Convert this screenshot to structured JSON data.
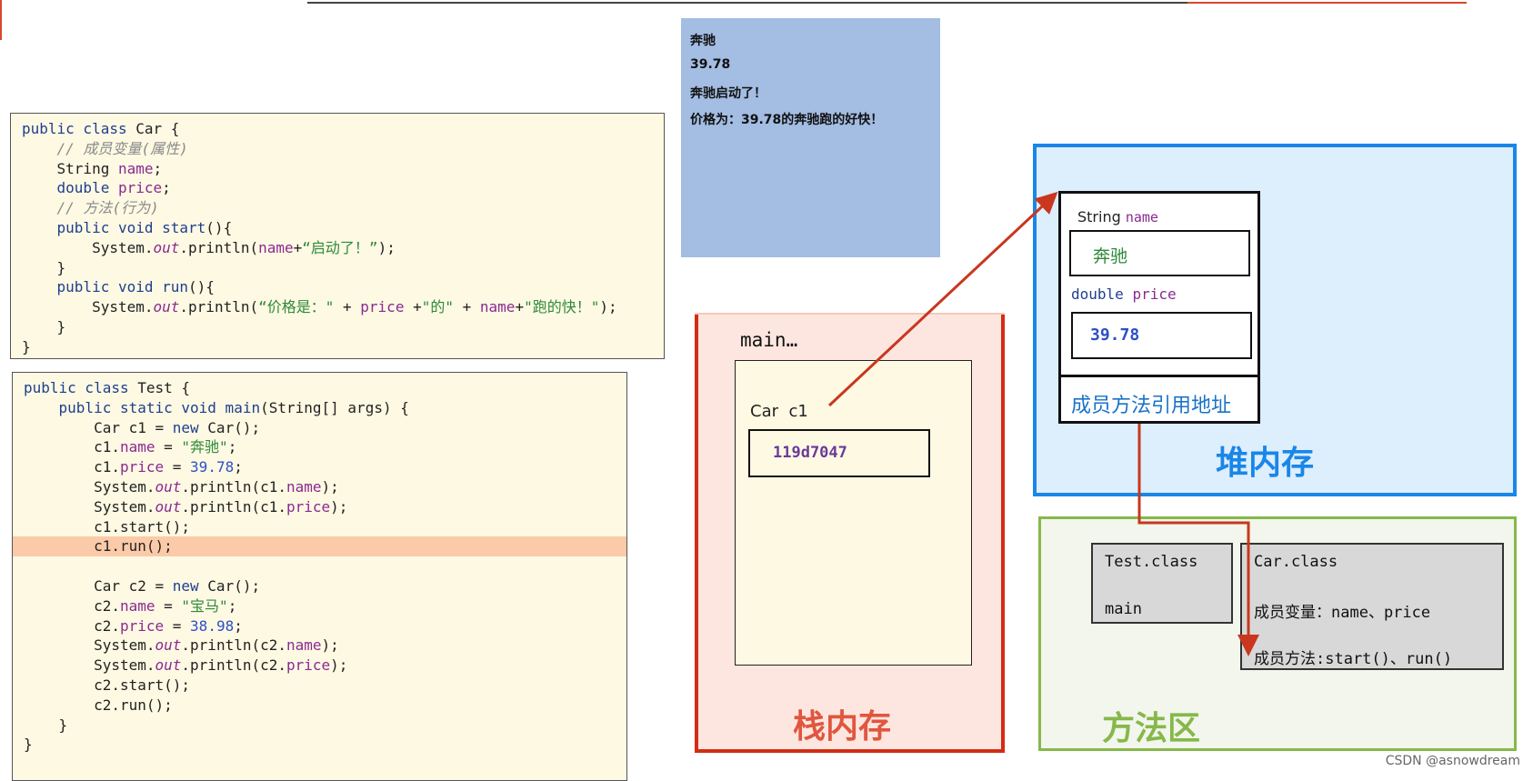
{
  "car_code": [
    [
      [
        "public class ",
        "kw"
      ],
      [
        "Car {",
        ""
      ]
    ],
    [
      [
        "    ",
        ""
      ],
      [
        "// 成员变量(属性)",
        "cm"
      ]
    ],
    [
      [
        "    String ",
        ""
      ],
      [
        "name",
        "fld"
      ],
      [
        ";",
        ""
      ]
    ],
    [
      [
        "    ",
        ""
      ],
      [
        "double ",
        "kw"
      ],
      [
        "price",
        "fld"
      ],
      [
        ";",
        ""
      ]
    ],
    [
      [
        "    ",
        ""
      ],
      [
        "// 方法(行为)",
        "cm"
      ]
    ],
    [
      [
        "    ",
        ""
      ],
      [
        "public void start",
        "kw"
      ],
      [
        "(){",
        ""
      ]
    ],
    [
      [
        "        System.",
        ""
      ],
      [
        "out",
        "it"
      ],
      [
        ".println(",
        ""
      ],
      [
        "name",
        "fld"
      ],
      [
        "+",
        ""
      ],
      [
        "“启动了！”",
        "str"
      ],
      [
        ");",
        ""
      ]
    ],
    [
      [
        "    }",
        ""
      ]
    ],
    [
      [
        "    ",
        ""
      ],
      [
        "public void run",
        "kw"
      ],
      [
        "(){",
        ""
      ]
    ],
    [
      [
        "        System.",
        ""
      ],
      [
        "out",
        "it"
      ],
      [
        ".println(",
        ""
      ],
      [
        "“价格是：\" ",
        "str"
      ],
      [
        "+ ",
        ""
      ],
      [
        "price",
        "fld"
      ],
      [
        " +",
        ""
      ],
      [
        "\"的\"",
        "str"
      ],
      [
        " + ",
        ""
      ],
      [
        "name",
        "fld"
      ],
      [
        "+",
        ""
      ],
      [
        "\"跑的快！\"",
        "str"
      ],
      [
        ");",
        ""
      ]
    ],
    [
      [
        "    }",
        ""
      ]
    ],
    [
      [
        "}",
        ""
      ]
    ]
  ],
  "test_code": [
    [
      [
        "public class ",
        "kw"
      ],
      [
        "Test {",
        ""
      ]
    ],
    [
      [
        "    ",
        ""
      ],
      [
        "public static void main",
        "kw"
      ],
      [
        "(String[] args) {",
        ""
      ]
    ],
    [
      [
        "        Car c1 = ",
        ""
      ],
      [
        "new ",
        "kw"
      ],
      [
        "Car();",
        ""
      ]
    ],
    [
      [
        "        c1.",
        ""
      ],
      [
        "name",
        "fld"
      ],
      [
        " = ",
        ""
      ],
      [
        "\"奔驰\"",
        "str"
      ],
      [
        ";",
        ""
      ]
    ],
    [
      [
        "        c1.",
        ""
      ],
      [
        "price",
        "fld"
      ],
      [
        " = ",
        ""
      ],
      [
        "39.78",
        "num"
      ],
      [
        ";",
        ""
      ]
    ],
    [
      [
        "        System.",
        ""
      ],
      [
        "out",
        "it"
      ],
      [
        ".println(c1.",
        ""
      ],
      [
        "name",
        "fld"
      ],
      [
        ");",
        ""
      ]
    ],
    [
      [
        "        System.",
        ""
      ],
      [
        "out",
        "it"
      ],
      [
        ".println(c1.",
        ""
      ],
      [
        "price",
        "fld"
      ],
      [
        ");",
        ""
      ]
    ],
    [
      [
        "        c1.start();",
        ""
      ]
    ],
    [
      [
        "        c1.run();",
        ""
      ]
    ],
    [
      [
        "",
        ""
      ]
    ],
    [
      [
        "        Car c2 = ",
        ""
      ],
      [
        "new ",
        "kw"
      ],
      [
        "Car();",
        ""
      ]
    ],
    [
      [
        "        c2.",
        ""
      ],
      [
        "name",
        "fld"
      ],
      [
        " = ",
        ""
      ],
      [
        "\"宝马\"",
        "str"
      ],
      [
        ";",
        ""
      ]
    ],
    [
      [
        "        c2.",
        ""
      ],
      [
        "price",
        "fld"
      ],
      [
        " = ",
        ""
      ],
      [
        "38.98",
        "num"
      ],
      [
        ";",
        ""
      ]
    ],
    [
      [
        "        System.",
        ""
      ],
      [
        "out",
        "it"
      ],
      [
        ".println(c2.",
        ""
      ],
      [
        "name",
        "fld"
      ],
      [
        ");",
        ""
      ]
    ],
    [
      [
        "        System.",
        ""
      ],
      [
        "out",
        "it"
      ],
      [
        ".println(c2.",
        ""
      ],
      [
        "price",
        "fld"
      ],
      [
        ");",
        ""
      ]
    ],
    [
      [
        "        c2.start();",
        ""
      ]
    ],
    [
      [
        "        c2.run();",
        ""
      ]
    ],
    [
      [
        "    }",
        ""
      ]
    ],
    [
      [
        "}",
        ""
      ]
    ]
  ],
  "highlighted_test_line": 8,
  "console": {
    "lines": [
      "奔驰",
      "39.78",
      "奔驰启动了！",
      "价格为：39.78的奔驰跑的好快！"
    ]
  },
  "stack": {
    "title": "栈内存",
    "frame_label": "main…",
    "var_label": "Car  c1",
    "address": "119d7047",
    "color": "#d42c14"
  },
  "heap": {
    "title": "堆内存",
    "field1_type": "String",
    "field1_name": "name",
    "field1_value": "奔驰",
    "field2_type": "double",
    "field2_name": "price",
    "field2_value": "39.78",
    "method_ref": "成员方法引用地址",
    "color": "#1a86e8"
  },
  "method_area": {
    "title": "方法区",
    "test_class": {
      "name": "Test.class",
      "method": "main"
    },
    "car_class": {
      "name": "Car.class",
      "fields": "成员变量：name、price",
      "methods": "成员方法:start()、run()"
    },
    "color": "#86b84a"
  },
  "watermark": "CSDN @asnowdream"
}
